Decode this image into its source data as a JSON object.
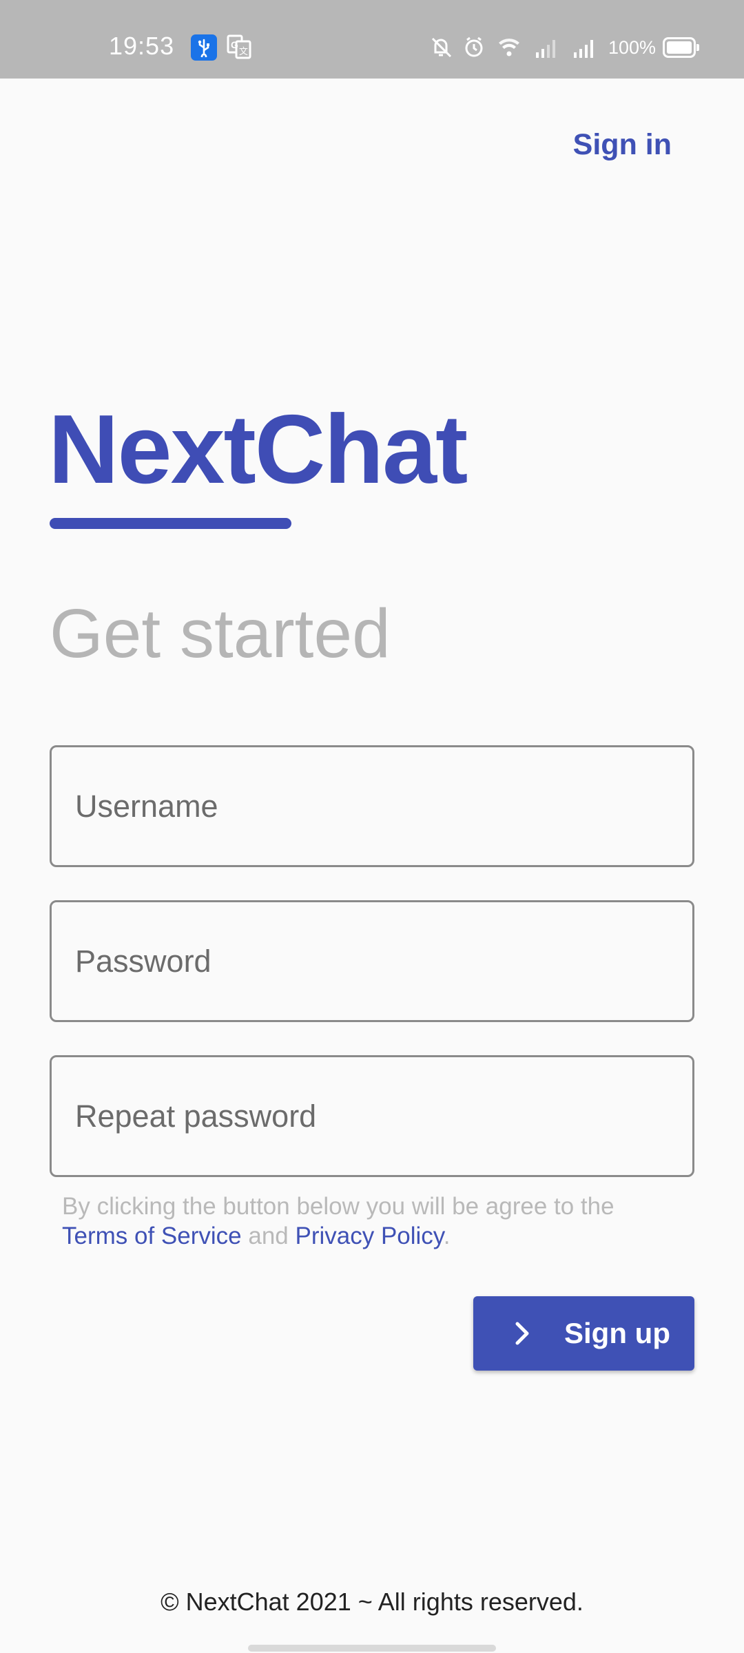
{
  "status_bar": {
    "time": "19:53",
    "battery": "100%",
    "icons": [
      "usb-icon",
      "translate-icon",
      "silent-icon",
      "alarm-icon",
      "wifi-icon",
      "signal-icon",
      "signal-icon",
      "battery-icon"
    ]
  },
  "header": {
    "signin_label": "Sign in"
  },
  "brand": {
    "logo_text": "NextChat",
    "accent_color": "#3f51b5"
  },
  "page": {
    "title": "Get started"
  },
  "form": {
    "username_placeholder": "Username",
    "password_placeholder": "Password",
    "repeat_password_placeholder": "Repeat password"
  },
  "terms": {
    "prefix": "By clicking the button below you will be agree to the ",
    "terms_link": "Terms of Service",
    "connector": " and ",
    "privacy_link": "Privacy Policy",
    "suffix": "."
  },
  "signup_button": {
    "label": "Sign up",
    "icon": "chevron-right-icon"
  },
  "footer": {
    "text": "© NextChat 2021 ~ All rights reserved."
  }
}
